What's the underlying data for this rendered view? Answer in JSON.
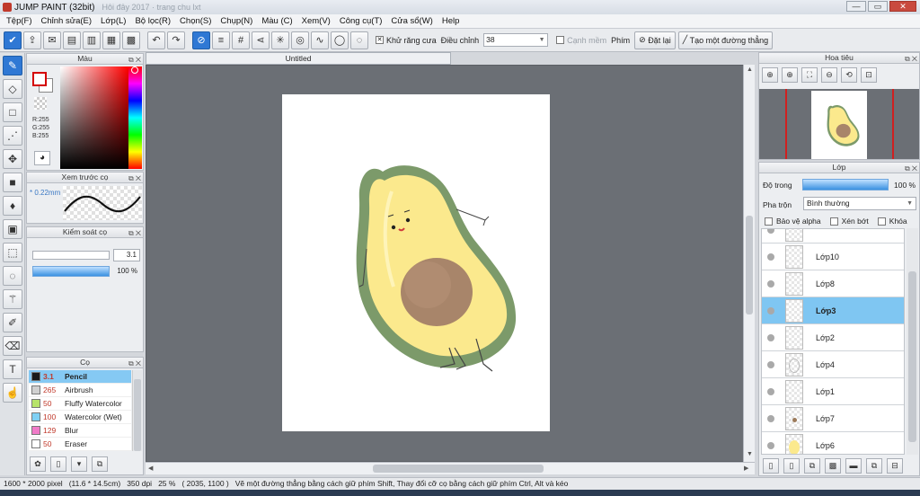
{
  "window": {
    "title": "JUMP PAINT (32bit)",
    "faded_title": "Hôi đây 2017 · trang chu lxt",
    "min": "—",
    "max": "▭",
    "close": "✕"
  },
  "menu": [
    "Tệp(F)",
    "Chỉnh sửa(E)",
    "Lớp(L)",
    "Bộ lọc(R)",
    "Chọn(S)",
    "Chụp(N)",
    "Màu (C)",
    "Xem(V)",
    "Công cụ(T)",
    "Cửa sổ(W)",
    "Help"
  ],
  "toolbar": {
    "antialias_label": "Khử răng cưa",
    "adjust_label": "Điều chỉnh",
    "adjust_value": "38",
    "edge_label": "Cạnh mềm",
    "key_label": "Phím",
    "reset_label": "Đặt lại",
    "make_line_label": "Tạo một đường thẳng",
    "antialias_check": "✕"
  },
  "color_panel": {
    "title": "Màu",
    "r": "R:255",
    "g": "G:255",
    "b": "B:255",
    "fg_color": "#ffffff"
  },
  "brush_preview": {
    "title": "Xem trước cọ",
    "size": "* 0.22mm"
  },
  "brush_control": {
    "title": "Kiểm soát cọ",
    "size": "3.1",
    "opacity": "100 %",
    "size_fraction": 0.0,
    "opacity_fraction": 1.0
  },
  "brush_panel": {
    "title": "Cọ",
    "brushes": [
      {
        "size": "3.1",
        "name": "Pencil",
        "color": "#1a1a1a"
      },
      {
        "size": "265",
        "name": "Airbrush",
        "color": "#d0d0d0"
      },
      {
        "size": "50",
        "name": "Fluffy Watercolor",
        "color": "#b7e36a"
      },
      {
        "size": "100",
        "name": "Watercolor (Wet)",
        "color": "#7fd0f4"
      },
      {
        "size": "129",
        "name": "Blur",
        "color": "#f07ac8"
      },
      {
        "size": "50",
        "name": "Eraser",
        "color": "#ffffff"
      }
    ]
  },
  "canvas": {
    "tab_title": "Untitled"
  },
  "navigator": {
    "title": "Hoa tiêu"
  },
  "layer_panel": {
    "title": "Lớp",
    "opacity_label": "Độ trong",
    "opacity_value": "100 %",
    "blend_label": "Pha trộn",
    "blend_value": "Bình thường",
    "protect_alpha": "Bảo vệ alpha",
    "clipping": "Xén bớt",
    "lock": "Khóa",
    "layers": [
      {
        "name": "Lớp10",
        "selected": false
      },
      {
        "name": "Lớp8",
        "selected": false
      },
      {
        "name": "Lớp3",
        "selected": true
      },
      {
        "name": "Lớp2",
        "selected": false
      },
      {
        "name": "Lớp4",
        "selected": false
      },
      {
        "name": "Lớp1",
        "selected": false
      },
      {
        "name": "Lớp7",
        "selected": false
      },
      {
        "name": "Lớp6",
        "selected": false
      }
    ]
  },
  "status": {
    "dimensions": "1600 * 2000 pixel",
    "size_cm": "(11.6 * 14.5cm)",
    "dpi": "350 dpi",
    "zoom": "25 %",
    "cursor": "( 2035, 1100 )",
    "hint": "Vẽ một đường thẳng bằng cách giữ phím Shift, Thay đổi cỡ cọ bằng cách giữ phím Ctrl, Alt và kéo"
  },
  "colors": {
    "accent": "#2f78d4",
    "selection": "#7fc6f2",
    "avocado_skin": "#7c9a6a",
    "avocado_flesh": "#fbe98d",
    "pit": "#9c7a5a"
  }
}
